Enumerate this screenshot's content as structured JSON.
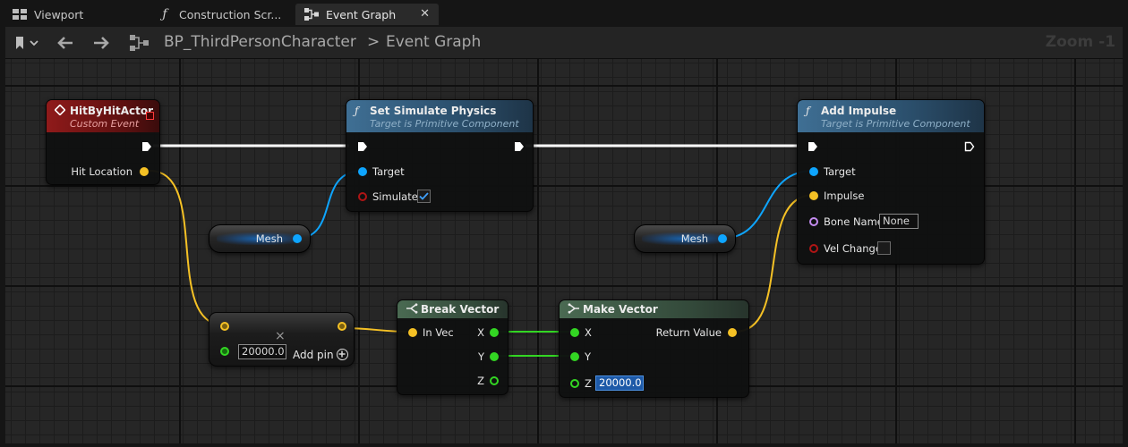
{
  "tabs": [
    {
      "label": "Viewport",
      "icon": "viewport-icon"
    },
    {
      "label": "Construction Scr...",
      "icon": "function-icon"
    },
    {
      "label": "Event Graph",
      "icon": "graph-icon",
      "active": true
    }
  ],
  "toolbar": {
    "breadcrumb_blueprint": "BP_ThirdPersonCharacter",
    "breadcrumb_separator": ">",
    "breadcrumb_graph": "Event Graph",
    "zoom": "Zoom -1"
  },
  "nodes": {
    "hit_event": {
      "title": "HitByHitActor",
      "subtitle": "Custom Event",
      "pin_hit_location": "Hit Location"
    },
    "set_physics": {
      "title": "Set Simulate Physics",
      "subtitle": "Target is Primitive Component",
      "pin_target": "Target",
      "pin_simulate": "Simulate",
      "simulate_checked": true
    },
    "add_impulse": {
      "title": "Add Impulse",
      "subtitle": "Target is Primitive Component",
      "pin_target": "Target",
      "pin_impulse": "Impulse",
      "pin_bone_name": "Bone Name",
      "bone_name_value": "None",
      "pin_vel_change": "Vel Change",
      "vel_change_checked": false
    },
    "mesh_1": {
      "label": "Mesh"
    },
    "mesh_2": {
      "label": "Mesh"
    },
    "multiply": {
      "value": "20000.0",
      "add_pin": "Add pin",
      "operator": "×"
    },
    "break_vector": {
      "title": "Break Vector",
      "pin_in": "In Vec",
      "pin_x": "X",
      "pin_y": "Y",
      "pin_z": "Z"
    },
    "make_vector": {
      "title": "Make Vector",
      "pin_x": "X",
      "pin_y": "Y",
      "pin_z": "Z",
      "z_value": "20000.0",
      "pin_return": "Return Value"
    }
  },
  "colors": {
    "exec": "#ffffff",
    "object_pin": "#0ea5ff",
    "vector_pin": "#f5c125",
    "float_pin": "#33d623",
    "bool_pin": "#b01515",
    "name_pin": "#c48cf0",
    "event_header": "#8a1616",
    "function_header": "#2f5a7a",
    "pure_header": "#3c5a44"
  }
}
